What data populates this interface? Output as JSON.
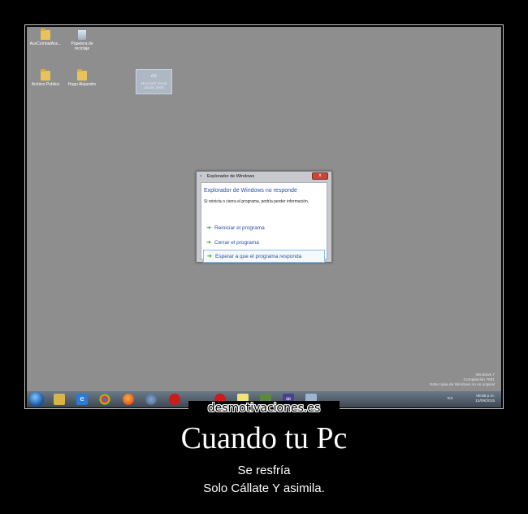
{
  "desktop": {
    "icons": [
      {
        "label": "AceCombatAss...",
        "kind": "folder"
      },
      {
        "label": "Papelera de reciclaje",
        "kind": "recycle-bin"
      },
      {
        "label": "Archivo Publico",
        "kind": "folder"
      },
      {
        "label": "Hugo Alejandro",
        "kind": "folder"
      },
      {
        "label": "Microsoft Visual Studio 2008",
        "kind": "shortcut"
      }
    ],
    "watermark": {
      "line1": "Windows 7",
      "line2": "Compilación 7601",
      "line3": "Esta copia de Windows no es original"
    }
  },
  "dialog": {
    "title": "Explorador de Windows",
    "close_label": "x",
    "heading": "Explorador de Windows no responde",
    "info": "Si reinicia o cierra el programa, podría perder información.",
    "options": [
      {
        "label": "Reiniciar el programa",
        "arrow": "➔"
      },
      {
        "label": "Cerrar el programa",
        "arrow": "➔"
      },
      {
        "label": "Esperar a que el programa responda",
        "arrow": "➔"
      }
    ]
  },
  "taskbar": {
    "apps": [
      "start-orb",
      "explorer",
      "internet-explorer",
      "chrome",
      "firefox",
      "steam",
      "opera",
      "opera",
      "sticky-notes",
      "minecraft",
      "visual-studio",
      "files"
    ],
    "tray": {
      "language": "ES",
      "time": "08:58 p.m.",
      "date": "12/09/2015"
    }
  },
  "poster": {
    "brand": "desmotivaciones.es",
    "title": "Cuando tu Pc",
    "line1": "Se resfría",
    "line2": "Solo Cállate Y asimila."
  }
}
